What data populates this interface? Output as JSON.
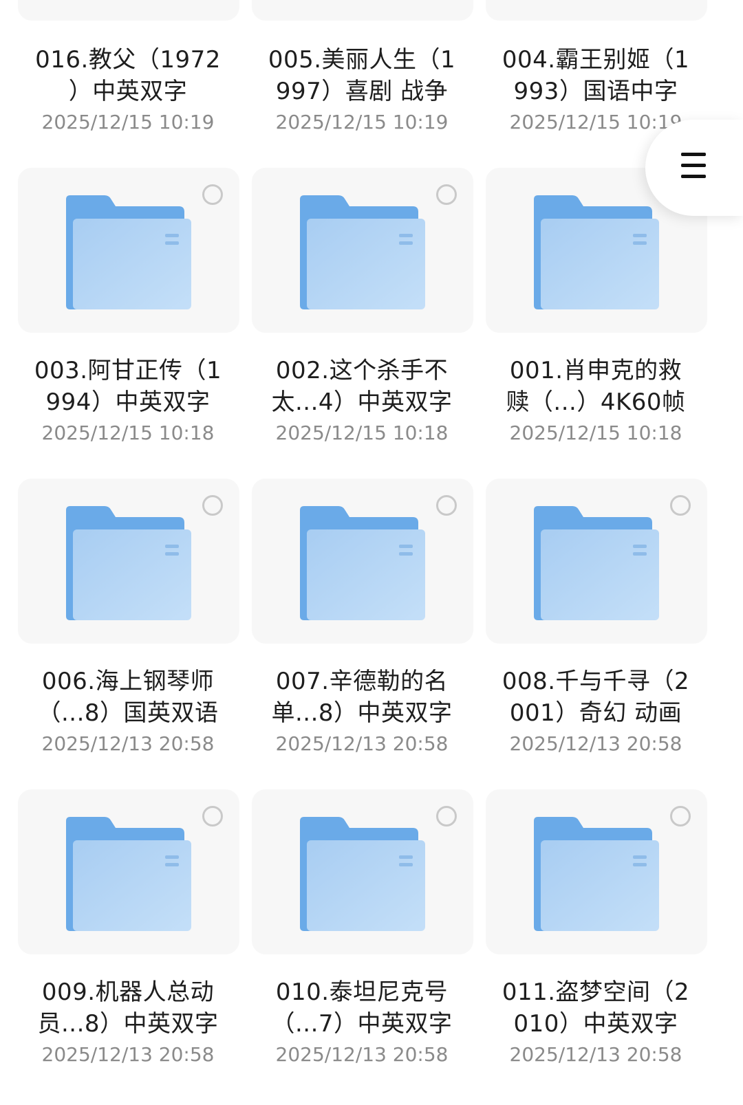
{
  "folders": [
    {
      "name_l1": "016.教父（1972",
      "name_l2": "）中英双字",
      "date": "2025/12/15 10:19"
    },
    {
      "name_l1": "005.美丽人生（1",
      "name_l2": "997）喜剧 战争",
      "date": "2025/12/15 10:19"
    },
    {
      "name_l1": "004.霸王别姬（1",
      "name_l2": "993）国语中字",
      "date": "2025/12/15 10:19"
    },
    {
      "name_l1": "003.阿甘正传（1",
      "name_l2": "994）中英双字",
      "date": "2025/12/15 10:18"
    },
    {
      "name_l1": "002.这个杀手不",
      "name_l2": "太...4）中英双字",
      "date": "2025/12/15 10:18"
    },
    {
      "name_l1": "001.肖申克的救",
      "name_l2": "赎（...）4K60帧",
      "date": "2025/12/15 10:18"
    },
    {
      "name_l1": "006.海上钢琴师",
      "name_l2": "（...8）国英双语",
      "date": "2025/12/13 20:58"
    },
    {
      "name_l1": "007.辛德勒的名",
      "name_l2": "单...8）中英双字",
      "date": "2025/12/13 20:58"
    },
    {
      "name_l1": "008.千与千寻（2",
      "name_l2": "001）奇幻 动画",
      "date": "2025/12/13 20:58"
    },
    {
      "name_l1": "009.机器人总动",
      "name_l2": "员...8）中英双字",
      "date": "2025/12/13 20:58"
    },
    {
      "name_l1": "010.泰坦尼克号",
      "name_l2": "（...7）中英双字",
      "date": "2025/12/13 20:58"
    },
    {
      "name_l1": "011.盗梦空间（2",
      "name_l2": "010）中英双字",
      "date": "2025/12/13 20:58"
    }
  ],
  "menu_button": {
    "icon": "menu-icon"
  },
  "colors": {
    "folder_back": "#6aaae8",
    "folder_front_top": "#a8cdf2",
    "folder_front_bottom": "#c4dff8",
    "card_bg": "#f7f7f7",
    "name_text": "#1e1e1e",
    "date_text": "#8a8a8a"
  }
}
